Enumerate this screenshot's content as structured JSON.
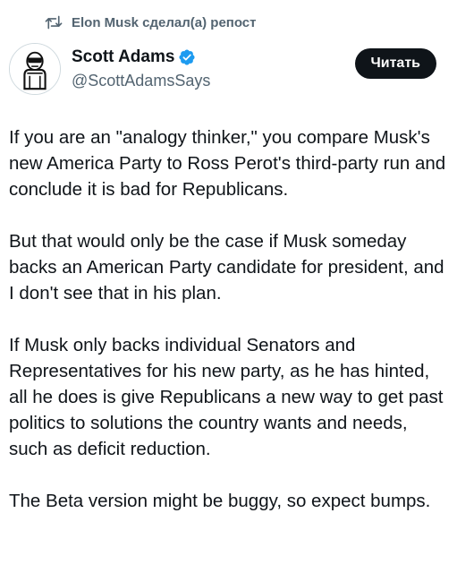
{
  "repost": {
    "text": "Elon Musk сделал(а) репост",
    "icon": "repost-icon"
  },
  "author": {
    "display_name": "Scott Adams",
    "handle": "@ScottAdamsSays",
    "verified": true,
    "verified_color": "#1d9bf0"
  },
  "actions": {
    "follow_label": "Читать"
  },
  "tweet": {
    "paragraphs": [
      "If you are an \"analogy thinker,\" you compare Musk's new America Party to Ross Perot's third-party run and conclude it is bad for Republicans.",
      "But that would only be the case if Musk someday backs an American Party candidate for president, and I don't see that in his plan.",
      "If Musk only backs individual Senators and Representatives for his new party, as he has hinted, all he does is give Republicans a new way to get past politics to solutions the country wants and needs, such as deficit reduction.",
      "The Beta version might be buggy, so expect bumps."
    ]
  }
}
